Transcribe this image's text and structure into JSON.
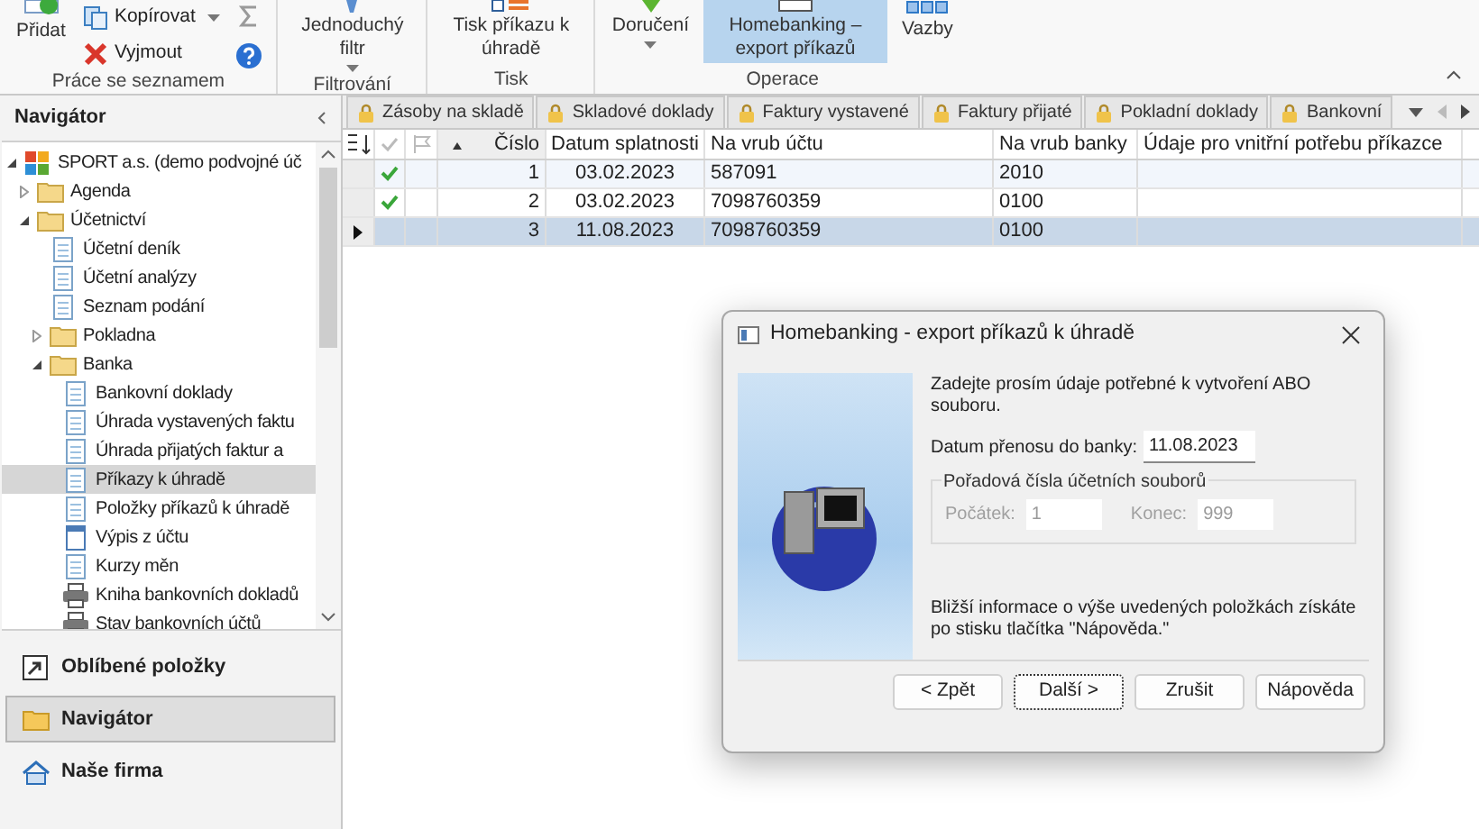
{
  "ribbon": {
    "groups": [
      {
        "label": "Práce se seznamem",
        "buttons": [
          {
            "kind": "large",
            "label": "Přidat",
            "selected": false
          },
          {
            "kind": "small",
            "label": "Kopírovat",
            "caret": true,
            "selected": false
          },
          {
            "kind": "small",
            "label": "Vyjmout",
            "selected": false
          },
          {
            "kind": "tiny",
            "selected": false
          },
          {
            "kind": "tiny",
            "selected": false
          }
        ]
      },
      {
        "label": "Filtrování",
        "buttons": [
          {
            "kind": "large",
            "label": "Jednoduchý filtr",
            "caret": true,
            "selected": false
          }
        ]
      },
      {
        "label": "Tisk",
        "buttons": [
          {
            "kind": "large",
            "label": "Tisk příkazu k úhradě",
            "selected": false
          }
        ]
      },
      {
        "label": "Operace",
        "buttons": [
          {
            "kind": "large",
            "label": "Doručení",
            "caret": true,
            "selected": false
          },
          {
            "kind": "large",
            "label": "Homebanking – export příkazů",
            "selected": true
          },
          {
            "kind": "large",
            "label": "Vazby",
            "selected": false
          }
        ]
      }
    ]
  },
  "navigator": {
    "title": "Navigátor",
    "tree": [
      {
        "label": "SPORT a.s. (demo podvojné úč",
        "kind": "company",
        "expanded": true,
        "selected": false,
        "children": [
          {
            "label": "Agenda",
            "kind": "folder",
            "expanded": false,
            "selected": false
          },
          {
            "label": "Účetnictví",
            "kind": "folder",
            "expanded": true,
            "selected": false,
            "children": [
              {
                "label": "Účetní deník",
                "kind": "doc",
                "selected": false
              },
              {
                "label": "Účetní analýzy",
                "kind": "doc",
                "selected": false
              },
              {
                "label": "Seznam podání",
                "kind": "doc",
                "selected": false
              },
              {
                "label": "Pokladna",
                "kind": "folder",
                "expanded": false,
                "selected": false
              },
              {
                "label": "Banka",
                "kind": "folder",
                "expanded": true,
                "selected": false,
                "children": [
                  {
                    "label": "Bankovní doklady",
                    "kind": "doc",
                    "selected": false
                  },
                  {
                    "label": "Úhrada vystavených faktu",
                    "kind": "doc",
                    "selected": false
                  },
                  {
                    "label": "Úhrada přijatých faktur a",
                    "kind": "doc",
                    "selected": false
                  },
                  {
                    "label": "Příkazy k úhradě",
                    "kind": "doc",
                    "selected": true
                  },
                  {
                    "label": "Položky příkazů k úhradě",
                    "kind": "doc",
                    "selected": false
                  },
                  {
                    "label": "Výpis z účtu",
                    "kind": "statement",
                    "selected": false
                  },
                  {
                    "label": "Kurzy měn",
                    "kind": "doc",
                    "selected": false
                  },
                  {
                    "label": "Kniha bankovních dokladů",
                    "kind": "print",
                    "selected": false
                  },
                  {
                    "label": "Stav bankovních účtů",
                    "kind": "print",
                    "selected": false
                  }
                ]
              }
            ]
          }
        ]
      }
    ]
  },
  "panels": [
    {
      "label": "Oblíbené položky",
      "selected": false
    },
    {
      "label": "Navigátor",
      "selected": true
    },
    {
      "label": "Naše firma",
      "selected": false
    }
  ],
  "tabs": [
    {
      "label": "Zásoby na skladě"
    },
    {
      "label": "Skladové doklady"
    },
    {
      "label": "Faktury vystavené"
    },
    {
      "label": "Faktury přijaté"
    },
    {
      "label": "Pokladní doklady"
    },
    {
      "label": "Bankovní"
    }
  ],
  "table": {
    "columns": [
      "Číslo",
      "Datum splatnosti",
      "Na vrub účtu",
      "Na vrub banky",
      "Údaje pro vnitřní potřebu příkazce"
    ],
    "rows": [
      {
        "checked": true,
        "selected": false,
        "current": false,
        "cells": [
          "1",
          "03.02.2023",
          "587091",
          "2010",
          ""
        ]
      },
      {
        "checked": true,
        "selected": false,
        "current": false,
        "cells": [
          "2",
          "03.02.2023",
          "7098760359",
          "0100",
          ""
        ]
      },
      {
        "checked": false,
        "selected": true,
        "current": true,
        "cells": [
          "3",
          "11.08.2023",
          "7098760359",
          "0100",
          ""
        ]
      }
    ]
  },
  "dialog": {
    "title": "Homebanking - export příkazů k úhradě",
    "intro": "Zadejte prosím údaje potřebné k vytvoření ABO souboru.",
    "date_label": "Datum přenosu do banky:",
    "date_value": "11.08.2023",
    "group_title": "Pořadová čísla účetních souborů",
    "fields": [
      {
        "label": "Počátek:",
        "value": "1",
        "disabled": true
      },
      {
        "label": "Konec:",
        "value": "999",
        "disabled": true
      }
    ],
    "info": "Bližší informace o výše uvedených položkách získáte po stisku tlačítka \"Nápověda.\"",
    "buttons": [
      {
        "label": "< Zpět",
        "focused": false
      },
      {
        "label": "Další >",
        "focused": true
      },
      {
        "label": "Zrušit",
        "focused": false
      },
      {
        "label": "Nápověda",
        "focused": false
      }
    ]
  }
}
